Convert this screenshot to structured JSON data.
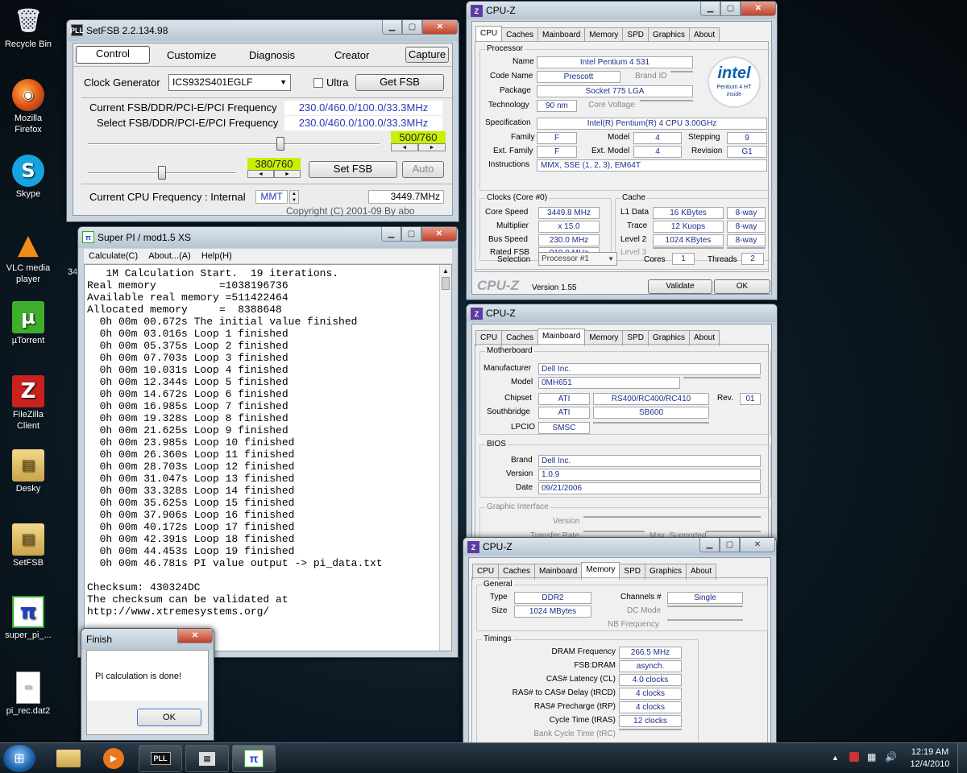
{
  "desktop": {
    "icons": [
      {
        "label": "Recycle Bin",
        "glyph": "🗑"
      },
      {
        "label": "Mozilla Firefox",
        "glyph": "◉"
      },
      {
        "label": "Skype",
        "glyph": "S"
      },
      {
        "label": "VLC media player",
        "glyph": "▲"
      },
      {
        "label": "µTorrent",
        "glyph": "µ"
      },
      {
        "label": "FileZilla Client",
        "glyph": "Z"
      },
      {
        "label": "Desky",
        "glyph": "▤"
      },
      {
        "label": "SetFSB",
        "glyph": "▤"
      },
      {
        "label": "super_pi_...",
        "glyph": "π"
      },
      {
        "label": "pi_rec.dat2",
        "glyph": "▭"
      }
    ],
    "partial_label": "34"
  },
  "setfsb": {
    "title": "SetFSB 2.2.134.98",
    "icon": "PLL",
    "tabs": [
      "Control",
      "Customize",
      "Diagnosis",
      "Creator"
    ],
    "capture": "Capture",
    "clock_label": "Clock Generator",
    "clock_value": "ICS932S401EGLF",
    "ultra": "Ultra",
    "get_fsb": "Get FSB",
    "current_label": "Current FSB/DDR/PCI-E/PCI Frequency",
    "current_value": "230.0/460.0/100.0/33.3MHz",
    "select_label": "Select FSB/DDR/PCI-E/PCI Frequency",
    "select_value": "230.0/460.0/100.0/33.3MHz",
    "slider1_value": "500/760",
    "slider1_level": 0.66,
    "slider2_value": "380/760",
    "slider2_level": 0.5,
    "set_fsb": "Set FSB",
    "auto": "Auto",
    "cpu_label": "Current CPU Frequency : Internal",
    "mmt": "MMT",
    "cpu_value": "3449.7MHz",
    "copyright": "Copyright (C) 2001-09 By abo"
  },
  "superpi": {
    "title": "Super PI / mod1.5 XS",
    "menu": [
      "Calculate(C)",
      "About...(A)",
      "Help(H)"
    ],
    "lines": [
      "   1M Calculation Start.  19 iterations.",
      "Real memory          =1038196736",
      "Available real memory =511422464",
      "Allocated memory     =  8388648",
      "  0h 00m 00.672s The initial value finished",
      "  0h 00m 03.016s Loop 1 finished",
      "  0h 00m 05.375s Loop 2 finished",
      "  0h 00m 07.703s Loop 3 finished",
      "  0h 00m 10.031s Loop 4 finished",
      "  0h 00m 12.344s Loop 5 finished",
      "  0h 00m 14.672s Loop 6 finished",
      "  0h 00m 16.985s Loop 7 finished",
      "  0h 00m 19.328s Loop 8 finished",
      "  0h 00m 21.625s Loop 9 finished",
      "  0h 00m 23.985s Loop 10 finished",
      "  0h 00m 26.360s Loop 11 finished",
      "  0h 00m 28.703s Loop 12 finished",
      "  0h 00m 31.047s Loop 13 finished",
      "  0h 00m 33.328s Loop 14 finished",
      "  0h 00m 35.625s Loop 15 finished",
      "  0h 00m 37.906s Loop 16 finished",
      "  0h 00m 40.172s Loop 17 finished",
      "  0h 00m 42.391s Loop 18 finished",
      "  0h 00m 44.453s Loop 19 finished",
      "  0h 00m 46.781s PI value output -> pi_data.txt",
      "",
      "Checksum: 430324DC",
      "The checksum can be validated at",
      "http://www.xtremesystems.org/"
    ]
  },
  "finish": {
    "title": "Finish",
    "message": "PI calculation is done!",
    "ok": "OK"
  },
  "cpuz_tabs": [
    "CPU",
    "Caches",
    "Mainboard",
    "Memory",
    "SPD",
    "Graphics",
    "About"
  ],
  "cpuz1": {
    "title": "CPU-Z",
    "processor": "Processor",
    "name_l": "Name",
    "name_v": "Intel Pentium 4 531",
    "code_l": "Code Name",
    "code_v": "Prescott",
    "brand_l": "Brand ID",
    "pkg_l": "Package",
    "pkg_v": "Socket 775 LGA",
    "tech_l": "Technology",
    "tech_v": "90 nm",
    "volt_l": "Core Voltage",
    "spec_l": "Specification",
    "spec_v": "Intel(R) Pentium(R) 4 CPU 3.00GHz",
    "fam_l": "Family",
    "fam_v": "F",
    "model_l": "Model",
    "model_v": "4",
    "step_l": "Stepping",
    "step_v": "9",
    "efam_l": "Ext. Family",
    "efam_v": "F",
    "emodel_l": "Ext. Model",
    "emodel_v": "4",
    "rev_l": "Revision",
    "rev_v": "G1",
    "instr_l": "Instructions",
    "instr_v": "MMX, SSE (1, 2, 3), EM64T",
    "intel_logo": "intel",
    "intel_sub": "Pentium 4 HT",
    "intel_inside": "inside",
    "clocks": "Clocks (Core #0)",
    "cs_l": "Core Speed",
    "cs_v": "3449.8 MHz",
    "mul_l": "Multiplier",
    "mul_v": "x 15.0",
    "bus_l": "Bus Speed",
    "bus_v": "230.0 MHz",
    "rfsb_l": "Rated FSB",
    "rfsb_v": "919.9 MHz",
    "cache": "Cache",
    "l1_l": "L1 Data",
    "l1_v": "16 KBytes",
    "l1_w": "8-way",
    "tr_l": "Trace",
    "tr_v": "12 Kuops",
    "tr_w": "8-way",
    "l2_l": "Level 2",
    "l2_v": "1024 KBytes",
    "l2_w": "8-way",
    "l3_l": "Level 3",
    "sel_l": "Selection",
    "sel_v": "Processor #1",
    "cores_l": "Cores",
    "cores_v": "1",
    "thr_l": "Threads",
    "thr_v": "2",
    "brand": "CPU-Z",
    "version": "Version 1.55",
    "validate": "Validate",
    "ok": "OK"
  },
  "cpuz2": {
    "title": "CPU-Z",
    "mb": "Motherboard",
    "man_l": "Manufacturer",
    "man_v": "Dell Inc.",
    "model_l": "Model",
    "model_v": "0MH651",
    "chip_l": "Chipset",
    "chip_v1": "ATI",
    "chip_v2": "RS400/RC400/RC410",
    "rev_l": "Rev.",
    "rev_v": "01",
    "sb_l": "Southbridge",
    "sb_v1": "ATI",
    "sb_v2": "SB600",
    "lpc_l": "LPCIO",
    "lpc_v": "SMSC",
    "bios": "BIOS",
    "brand_l": "Brand",
    "brand_v": "Dell Inc.",
    "ver_l": "Version",
    "ver_v": "1.0.9",
    "date_l": "Date",
    "date_v": "09/21/2006",
    "gi": "Graphic Interface",
    "gi_ver": "Version",
    "gi_rate": "Transfer Rate",
    "gi_max": "Max. Supported"
  },
  "cpuz3": {
    "title": "CPU-Z",
    "general": "General",
    "type_l": "Type",
    "type_v": "DDR2",
    "ch_l": "Channels #",
    "ch_v": "Single",
    "size_l": "Size",
    "size_v": "1024 MBytes",
    "dc_l": "DC Mode",
    "nb_l": "NB Frequency",
    "timings": "Timings",
    "rows": [
      {
        "l": "DRAM Frequency",
        "v": "266.5 MHz"
      },
      {
        "l": "FSB:DRAM",
        "v": "asynch."
      },
      {
        "l": "CAS# Latency (CL)",
        "v": "4.0 clocks"
      },
      {
        "l": "RAS# to CAS# Delay (tRCD)",
        "v": "4 clocks"
      },
      {
        "l": "RAS# Precharge (tRP)",
        "v": "4 clocks"
      },
      {
        "l": "Cycle Time (tRAS)",
        "v": "12 clocks"
      },
      {
        "l": "Bank Cycle Time (tRC)",
        "v": ""
      }
    ]
  },
  "taskbar": {
    "time": "12:19 AM",
    "date": "12/4/2010"
  }
}
